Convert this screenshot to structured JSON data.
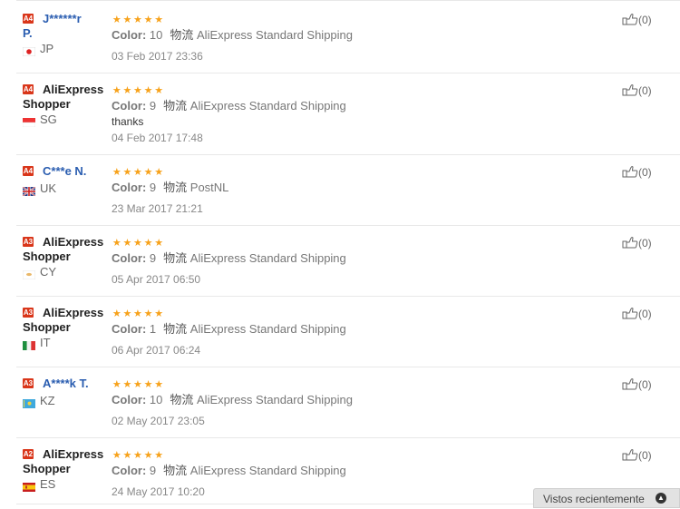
{
  "reviews": [
    {
      "level": "A4",
      "name_line1": "J******r",
      "name_line2": "P.",
      "name_style": "masked",
      "country_code": "JP",
      "flag": "jp",
      "color_label": "Color:",
      "color_value": "10",
      "ship_label": "物流",
      "shipping": "AliExpress Standard Shipping",
      "feedback": "",
      "date": "03 Feb 2017 23:36",
      "helpful": "(0)"
    },
    {
      "level": "A4",
      "name_line1": "AliExpress",
      "name_line2": "Shopper",
      "name_style": "shopper",
      "country_code": "SG",
      "flag": "sg",
      "color_label": "Color:",
      "color_value": "9",
      "ship_label": "物流",
      "shipping": "AliExpress Standard Shipping",
      "feedback": "thanks",
      "date": "04 Feb 2017 17:48",
      "helpful": "(0)"
    },
    {
      "level": "A4",
      "name_line1": "C***e N.",
      "name_line2": "",
      "name_style": "masked",
      "country_code": "UK",
      "flag": "uk",
      "color_label": "Color:",
      "color_value": "9",
      "ship_label": "物流",
      "shipping": "PostNL",
      "feedback": "",
      "date": "23 Mar 2017 21:21",
      "helpful": "(0)"
    },
    {
      "level": "A3",
      "name_line1": "AliExpress",
      "name_line2": "Shopper",
      "name_style": "shopper",
      "country_code": "CY",
      "flag": "cy",
      "color_label": "Color:",
      "color_value": "9",
      "ship_label": "物流",
      "shipping": "AliExpress Standard Shipping",
      "feedback": "",
      "date": "05 Apr 2017 06:50",
      "helpful": "(0)"
    },
    {
      "level": "A3",
      "name_line1": "AliExpress",
      "name_line2": "Shopper",
      "name_style": "shopper",
      "country_code": "IT",
      "flag": "it",
      "color_label": "Color:",
      "color_value": "1",
      "ship_label": "物流",
      "shipping": "AliExpress Standard Shipping",
      "feedback": "",
      "date": "06 Apr 2017 06:24",
      "helpful": "(0)"
    },
    {
      "level": "A3",
      "name_line1": "A****k T.",
      "name_line2": "",
      "name_style": "masked",
      "country_code": "KZ",
      "flag": "kz",
      "color_label": "Color:",
      "color_value": "10",
      "ship_label": "物流",
      "shipping": "AliExpress Standard Shipping",
      "feedback": "",
      "date": "02 May 2017 23:05",
      "helpful": "(0)"
    },
    {
      "level": "A2",
      "name_line1": "AliExpress",
      "name_line2": "Shopper",
      "name_style": "shopper",
      "country_code": "ES",
      "flag": "es",
      "color_label": "Color:",
      "color_value": "9",
      "ship_label": "物流",
      "shipping": "AliExpress Standard Shipping",
      "feedback": "",
      "date": "24 May 2017 10:20",
      "helpful": "(0)"
    }
  ],
  "rating_stars": 5,
  "colors": {
    "star": "#f7a21b",
    "badge": "#d9361a",
    "link": "#2a5db0"
  },
  "recently_viewed": {
    "label": "Vistos recientemente",
    "icon": "chevron-up-icon"
  }
}
